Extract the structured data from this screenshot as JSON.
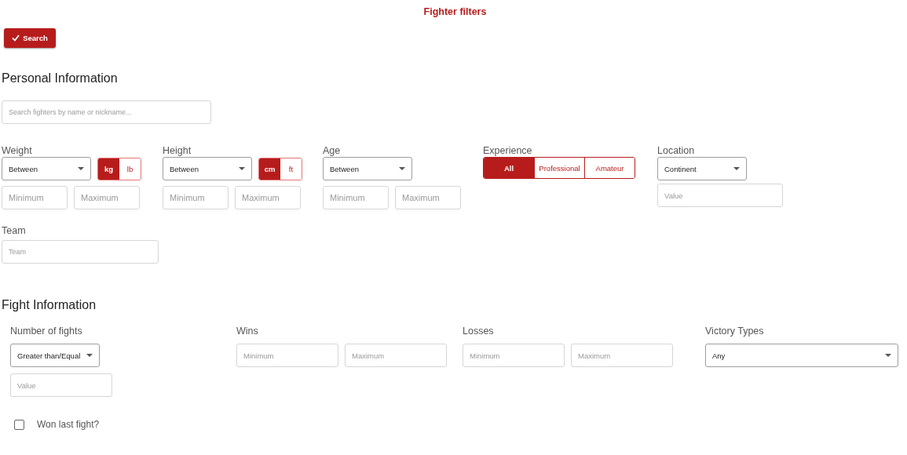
{
  "title": "Fighter filters",
  "search_button": {
    "label": "Search"
  },
  "personal": {
    "heading": "Personal Information",
    "search": {
      "placeholder": "Search fighters by name or nickname..."
    },
    "filters": [
      {
        "kind": "range",
        "label": "Weight",
        "select": "Between",
        "units": [
          {
            "label": "kg",
            "selected": true
          },
          {
            "label": "lb",
            "selected": false
          }
        ],
        "min_placeholder": "Minimum",
        "max_placeholder": "Maximum"
      },
      {
        "kind": "range",
        "label": "Height",
        "select": "Between",
        "units": [
          {
            "label": "cm",
            "selected": true
          },
          {
            "label": "ft",
            "selected": false
          }
        ],
        "min_placeholder": "Minimum",
        "max_placeholder": "Maximum"
      },
      {
        "kind": "range",
        "label": "Age",
        "select": "Between",
        "min_placeholder": "Minimum",
        "max_placeholder": "Maximum"
      },
      {
        "kind": "segmented",
        "label": "Experience",
        "options": [
          {
            "label": "All",
            "selected": true
          },
          {
            "label": "Professional",
            "selected": false
          },
          {
            "label": "Amateur",
            "selected": false
          }
        ]
      },
      {
        "kind": "location",
        "label": "Location",
        "select": "Continent",
        "placeholder": "Value"
      }
    ],
    "team": {
      "label": "Team",
      "placeholder": "Team"
    }
  },
  "fight": {
    "heading": "Fight Information",
    "filters": [
      {
        "kind": "compare",
        "label": "Number of fights",
        "select": "Greater than/Equal",
        "placeholder": "Value"
      },
      {
        "kind": "minmax",
        "label": "Wins",
        "min_placeholder": "Minimum",
        "max_placeholder": "Maximum"
      },
      {
        "kind": "minmax",
        "label": "Losses",
        "min_placeholder": "Minimum",
        "max_placeholder": "Maximum"
      },
      {
        "kind": "dropdown",
        "label": "Victory Types",
        "select": "Any"
      }
    ],
    "won_last": {
      "label": "Won last fight?",
      "checked": false
    }
  }
}
